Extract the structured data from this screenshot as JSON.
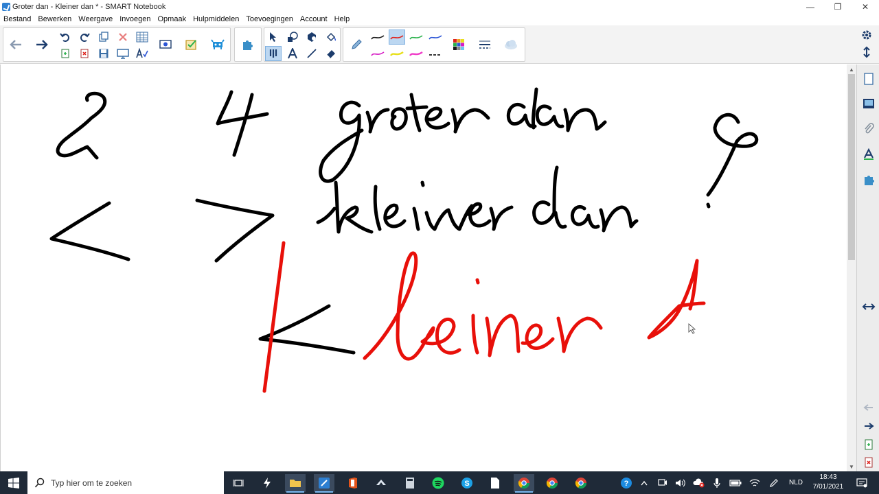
{
  "window": {
    "title": "Groter dan - Kleiner dan * - SMART Notebook",
    "controls": {
      "minimize": "—",
      "restore": "❐",
      "close": "✕"
    }
  },
  "menu": [
    "Bestand",
    "Bewerken",
    "Weergave",
    "Invoegen",
    "Opmaak",
    "Hulpmiddelen",
    "Toevoegingen",
    "Account",
    "Help"
  ],
  "toolbar": {
    "icons": [
      "back-arrow",
      "forward-arrow",
      "undo",
      "redo",
      "insert-page",
      "delete",
      "table",
      "screen-capture",
      "save",
      "fullscreen",
      "spellcheck",
      "document-camera",
      "response",
      "add-on",
      "puzzle",
      "select",
      "shapes",
      "fill",
      "pen",
      "text",
      "line",
      "eraser",
      "pen-black",
      "pen-red",
      "pen-green",
      "pen-blue",
      "pen-magenta",
      "pen-yellow",
      "pen-pink",
      "pen-dashed",
      "color-palette",
      "line-style",
      "properties"
    ],
    "colors": {
      "black": "#1a1a1a",
      "red": "#e0221c",
      "green": "#2bb24c",
      "blue": "#2c55d6",
      "magenta": "#d61cc4",
      "yellow": "#e8e01c",
      "pink": "#f03cc8"
    }
  },
  "canvas": {
    "ink_black": "#000000",
    "ink_red": "#e8100a",
    "handwriting": [
      "2",
      "4",
      "groter dan",
      "kleiner dan",
      "?",
      "<",
      ">",
      "Kleiner A"
    ]
  },
  "sidebar": {
    "icons": [
      "page-sorter",
      "gallery",
      "attachments",
      "properties",
      "add-ons"
    ],
    "bottom": [
      "back-arrow",
      "forward-arrow",
      "add-page",
      "delete-page"
    ]
  },
  "taskbar": {
    "search_placeholder": "Typ hier om te zoeken",
    "language": "NLD",
    "time": "18:43",
    "date": "7/01/2021"
  }
}
